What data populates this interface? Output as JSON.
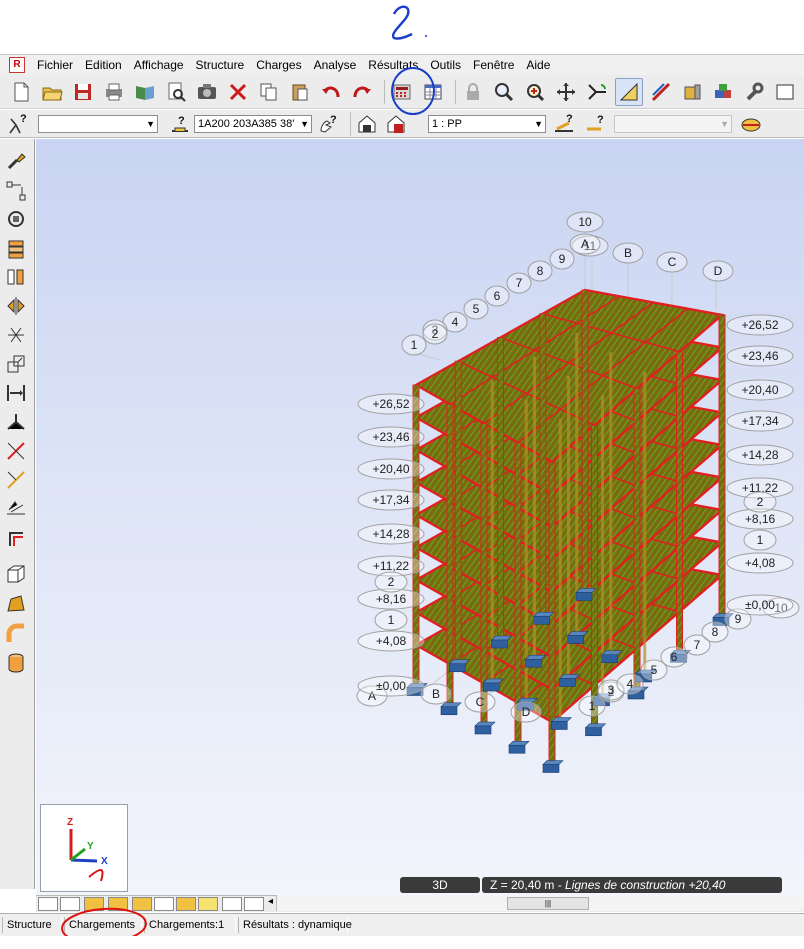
{
  "menu": [
    "Fichier",
    "Edition",
    "Affichage",
    "Structure",
    "Charges",
    "Analyse",
    "Résultats",
    "Outils",
    "Fenêtre",
    "Aide"
  ],
  "toolbar2": {
    "combo_section": "1A200 203A385 38'",
    "combo_case": "1 : PP",
    "help_glyph": "?"
  },
  "grid_labels": {
    "numbers": [
      "10",
      "11",
      "9",
      "8",
      "7",
      "6",
      "5",
      "4",
      "3",
      "2",
      "1"
    ],
    "letters": [
      "A",
      "B",
      "C",
      "D"
    ]
  },
  "levels_right": [
    "+26,52",
    "+23,46",
    "+20,40",
    "+17,34",
    "+14,28",
    "+11,22",
    "+8,16",
    "+4,08",
    "±0,00"
  ],
  "levels_left": [
    "+26,52",
    "+23,46",
    "+20,40",
    "+17,34",
    "+14,28",
    "+11,22",
    "+8,16",
    "+4,08",
    "±0,00"
  ],
  "axes": {
    "z": "Z",
    "y": "Y",
    "x": "X"
  },
  "viewport_info": {
    "mode": "3D",
    "z_prefix": "Z = 20,40 m - ",
    "z_detail": "Lignes de construction +20,40"
  },
  "hscroll_glyph": "|||",
  "status": {
    "structure": "Structure",
    "chargements": "Chargements",
    "chargements_count": "Chargements:1",
    "resultats": "Résultats : dynamique"
  },
  "colors": {
    "frame_red": "#e02020",
    "slab_fill": "#7a6a10",
    "slab_hatch": "#5dbb2a",
    "support_blue": "#2e5f9e",
    "annotation_blue": "#1a3ec8",
    "annotation_red": "#e01010"
  }
}
